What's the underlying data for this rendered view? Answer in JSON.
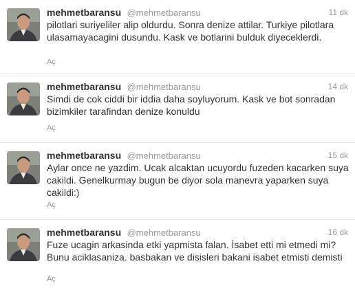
{
  "tweets": [
    {
      "fullname": "mehmetbaransu",
      "username": "@mehmetbaransu",
      "time": "11 dk",
      "text": "pilotlari suriyeliler alip oldurdu. Sonra denize attilar. Turkiye pilotlara ulasamayacagini dusundu. Kask ve botlarini bulduk diyeceklerdi.",
      "expand": "Aç"
    },
    {
      "fullname": "mehmetbaransu",
      "username": "@mehmetbaransu",
      "time": "14 dk",
      "text": "Simdi de cok ciddi bir iddia daha soyluyorum. Kask ve bot sonradan bizimkiler tarafindan denize konuldu",
      "expand": "Aç"
    },
    {
      "fullname": "mehmetbaransu",
      "username": "@mehmetbaransu",
      "time": "15 dk",
      "text": "Aylar once ne yazdim. Ucak alcaktan ucuyordu fuzeden kacarken suya cakildi. Genelkurmay bugun be diyor sola manevra yaparken suya cakildi:)",
      "expand": "Aç"
    },
    {
      "fullname": "mehmetbaransu",
      "username": "@mehmetbaransu",
      "time": "16 dk",
      "text": "Fuze ucagin arkasinda etki yapmista falan. İsabet etti mi etmedi mi? Bunu aciklasaniza. basbakan ve disisleri bakani isabet etmisti demisti",
      "expand": "Aç"
    }
  ]
}
